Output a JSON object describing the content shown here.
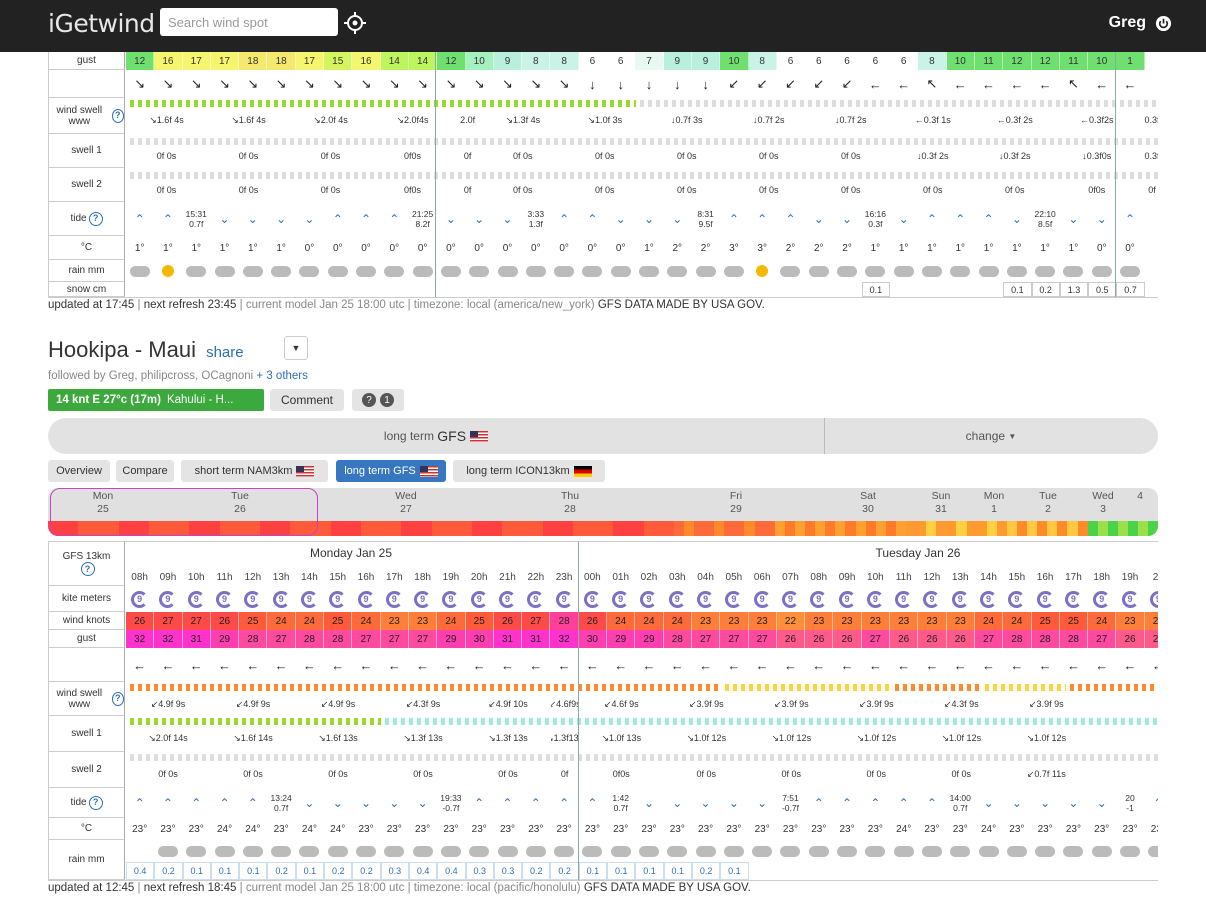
{
  "header": {
    "logo": "iGetwind",
    "search_placeholder": "Search wind spot",
    "user_name": "Greg"
  },
  "top_spot": {
    "row_labels": [
      "gust",
      "",
      "wind swell www",
      "swell 1",
      "swell 2",
      "tide",
      "°C",
      "rain mm",
      "snow cm"
    ],
    "gust": [
      "12",
      "16",
      "17",
      "17",
      "18",
      "18",
      "17",
      "15",
      "16",
      "14",
      "14",
      "12",
      "10",
      "9",
      "8",
      "8",
      "6",
      "6",
      "7",
      "9",
      "9",
      "10",
      "8",
      "6",
      "6",
      "6",
      "6",
      "6",
      "8",
      "10",
      "11",
      "12",
      "12",
      "11",
      "10",
      "1"
    ],
    "gust_colors": [
      "#6fe06f",
      "#f5f56e",
      "#f5f56e",
      "#f5f56e",
      "#f5e86e",
      "#f5e86e",
      "#f5f56e",
      "#d4f55e",
      "#f5f56e",
      "#bdf55e",
      "#bdf55e",
      "#6fe06f",
      "#a6f0c0",
      "#b8f0dd",
      "#c8f3e6",
      "#c8f3e6",
      "#fff",
      "#fff",
      "#eaf8f2",
      "#b8f0dd",
      "#b8f0dd",
      "#6fe06f",
      "#c8f3e6",
      "#fff",
      "#fff",
      "#fff",
      "#fff",
      "#fff",
      "#c8f3e6",
      "#6fe06f",
      "#6fe06f",
      "#6fe06f",
      "#6fe06f",
      "#6fe06f",
      "#6fe06f",
      "#6fe06f"
    ],
    "arrows": [
      "↘",
      "↘",
      "↘",
      "↘",
      "↘",
      "↘",
      "↘",
      "↘",
      "↘",
      "↘",
      "↘",
      "↘",
      "↘",
      "↘",
      "↘",
      "↘",
      "↓",
      "↓",
      "↓",
      "↓",
      "↓",
      "↙",
      "↙",
      "↙",
      "↙",
      "↙",
      "←",
      "←",
      "↖",
      "←",
      "←",
      "←",
      "←",
      "↖",
      "←",
      "←"
    ],
    "wind_swell": [
      "↘1.6f 4s",
      "↘1.6f 4s",
      "↘2.0f 4s",
      "↘2.0f4s",
      "2.0f",
      "↘1.3f 4s",
      "↘1.0f 3s",
      "↓0.7f 3s",
      "↓0.7f 2s",
      "↓0.7f 2s",
      "←0.3f 1s",
      "←0.3f 2s",
      "←0.3f2s",
      "0.3f"
    ],
    "swell1": [
      "0f 0s",
      "0f 0s",
      "0f 0s",
      "0f0s",
      "0f",
      "0f 0s",
      "0f 0s",
      "0f 0s",
      "0f 0s",
      "0f 0s",
      "↓0.3f 2s",
      "↓0.3f 2s",
      "↓0.3f0s",
      "0.3f"
    ],
    "swell2": [
      "0f 0s",
      "0f 0s",
      "0f 0s",
      "0f0s",
      "0f",
      "0f 0s",
      "0f 0s",
      "0f 0s",
      "0f 0s",
      "0f 0s",
      "0f 0s",
      "0f 0s",
      "0f0s",
      "0f"
    ],
    "tide_labels": [
      {
        "time": "15:31",
        "h": "0.7f"
      },
      {
        "time": "21:25",
        "h": "8.2f"
      },
      {
        "time": "3:33",
        "h": "1.3f"
      },
      {
        "time": "8:31",
        "h": "9.5f"
      },
      {
        "time": "16:16",
        "h": "0.3f"
      },
      {
        "time": "22:10",
        "h": "8.5f"
      }
    ],
    "temps": [
      "1°",
      "1°",
      "1°",
      "1°",
      "1°",
      "1°",
      "0°",
      "0°",
      "0°",
      "0°",
      "0°",
      "0°",
      "0°",
      "0°",
      "0°",
      "0°",
      "0°",
      "0°",
      "1°",
      "2°",
      "2°",
      "3°",
      "3°",
      "2°",
      "2°",
      "2°",
      "1°",
      "1°",
      "1°",
      "1°",
      "1°",
      "1°",
      "1°",
      "1°",
      "0°",
      "0°"
    ],
    "snow": [
      "0.1",
      "0.1",
      "0.2",
      "1.3",
      "0.5",
      "0.7"
    ],
    "footer_updated": "updated at 17:45",
    "footer_refresh": "next refresh 23:45",
    "footer_model": "current model Jan 25 18:00 utc",
    "footer_tz": "timezone: local (america/new_york)",
    "footer_gfs": "GFS DATA MADE BY USA GOV."
  },
  "spot": {
    "title": "Hookipa - Maui",
    "share": "share",
    "followed_prefix": "followed by",
    "followed_names": "Greg, philipcross, OCagnoni",
    "followed_more": "+ 3 others",
    "live_wind": "14 knt E 27°c (17m)",
    "live_station": "Kahului - H...",
    "comment_label": "Comment",
    "help_count": "1"
  },
  "model_bar": {
    "label": "long term",
    "model": "GFS",
    "change": "change"
  },
  "tabs": [
    {
      "label": "Overview"
    },
    {
      "label": "Compare"
    },
    {
      "label": "short term NAM3km"
    },
    {
      "label": "long term GFS"
    },
    {
      "label": "long term ICON13km"
    }
  ],
  "timeline_days": [
    {
      "d": "Mon",
      "n": "25"
    },
    {
      "d": "Tue",
      "n": "26"
    },
    {
      "d": "Wed",
      "n": "27"
    },
    {
      "d": "Thu",
      "n": "28"
    },
    {
      "d": "Fri",
      "n": "29"
    },
    {
      "d": "Sat",
      "n": "30"
    },
    {
      "d": "Sun",
      "n": "31"
    },
    {
      "d": "Mon",
      "n": "1"
    },
    {
      "d": "Tue",
      "n": "2"
    },
    {
      "d": "Wed",
      "n": "3"
    },
    {
      "d": "",
      "n": "4"
    }
  ],
  "forecast": {
    "model_label": "GFS 13km",
    "day1": "Monday Jan 25",
    "day2": "Tuesday Jan 26",
    "row_labels": [
      "kite meters",
      "wind knots",
      "gust",
      "",
      "wind swell www",
      "swell 1",
      "swell 2",
      "tide",
      "°C",
      "rain mm"
    ],
    "hours": [
      "08h",
      "09h",
      "10h",
      "11h",
      "12h",
      "13h",
      "14h",
      "15h",
      "16h",
      "17h",
      "18h",
      "19h",
      "20h",
      "21h",
      "22h",
      "23h",
      "00h",
      "01h",
      "02h",
      "03h",
      "04h",
      "05h",
      "06h",
      "07h",
      "08h",
      "09h",
      "10h",
      "11h",
      "12h",
      "13h",
      "14h",
      "15h",
      "16h",
      "17h",
      "18h",
      "19h",
      "20"
    ],
    "kite": [
      "9",
      "9",
      "9",
      "9",
      "9",
      "9",
      "9",
      "9",
      "9",
      "9",
      "9",
      "9",
      "9",
      "9",
      "9",
      "9",
      "9",
      "9",
      "9",
      "9",
      "9",
      "9",
      "9",
      "9",
      "9",
      "9",
      "9",
      "9",
      "9",
      "9",
      "9",
      "9",
      "9",
      "9",
      "9",
      "9",
      "9"
    ],
    "wind": [
      "26",
      "27",
      "27",
      "26",
      "25",
      "24",
      "24",
      "25",
      "24",
      "23",
      "23",
      "24",
      "25",
      "26",
      "27",
      "28",
      "26",
      "24",
      "24",
      "24",
      "23",
      "23",
      "23",
      "22",
      "23",
      "23",
      "23",
      "23",
      "23",
      "23",
      "24",
      "24",
      "25",
      "25",
      "24",
      "23",
      "23"
    ],
    "gust": [
      "32",
      "32",
      "31",
      "29",
      "28",
      "27",
      "28",
      "28",
      "27",
      "27",
      "27",
      "29",
      "30",
      "31",
      "31",
      "32",
      "30",
      "29",
      "29",
      "28",
      "27",
      "27",
      "27",
      "26",
      "26",
      "26",
      "27",
      "26",
      "26",
      "26",
      "27",
      "28",
      "28",
      "28",
      "27",
      "26",
      "26"
    ],
    "wind_swell": [
      "↙4.9f 9s",
      "↙4.9f 9s",
      "↙4.9f 9s",
      "↙4.3f 9s",
      "↙4.9f 10s",
      "↙4.6f9s",
      "↙4.6f 9s",
      "↙3.9f 9s",
      "↙3.9f 9s",
      "↙3.9f 9s",
      "↙4.3f 9s",
      "↙3.9f 9s"
    ],
    "swell1": [
      "↘2.0f 14s",
      "↘1.6f 14s",
      "↘1.6f 13s",
      "↘1.3f 13s",
      "↘1.3f 13s",
      "↘1.3f13s",
      "↘1.0f 13s",
      "↘1.0f 12s",
      "↘1.0f 12s",
      "↘1.0f 12s",
      "↘1.0f 12s",
      "↘1.0f 12s"
    ],
    "swell2": [
      "0f 0s",
      "0f 0s",
      "0f 0s",
      "0f 0s",
      "0f 0s",
      "0f",
      "0f0s",
      "0f 0s",
      "0f 0s",
      "0f 0s",
      "0f 0s",
      "↙0.7f 11s"
    ],
    "tide_labels": [
      {
        "time": "13:24",
        "h": "0.7f"
      },
      {
        "time": "19:33",
        "h": "-0.7f"
      },
      {
        "time": "1:42",
        "h": "0.7f"
      },
      {
        "time": "7:51",
        "h": "-0.7f"
      },
      {
        "time": "14:00",
        "h": "0.7f"
      },
      {
        "time": "20",
        "h": "-1"
      }
    ],
    "temps": [
      "23°",
      "23°",
      "23°",
      "24°",
      "24°",
      "23°",
      "24°",
      "24°",
      "23°",
      "23°",
      "23°",
      "23°",
      "23°",
      "23°",
      "23°",
      "23°",
      "23°",
      "23°",
      "23°",
      "23°",
      "23°",
      "23°",
      "23°",
      "23°",
      "23°",
      "23°",
      "23°",
      "24°",
      "23°",
      "23°",
      "24°",
      "23°",
      "23°",
      "23°",
      "23°",
      "23°",
      "23°"
    ],
    "rain": [
      "0.4",
      "0.2",
      "0.1",
      "0.1",
      "0.1",
      "0.2",
      "0.1",
      "0.2",
      "0.2",
      "0.3",
      "0.4",
      "0.4",
      "0.3",
      "0.3",
      "0.2",
      "0.2",
      "0.1",
      "0.1",
      "0.1",
      "0.1",
      "0.2",
      "0.1"
    ],
    "footer_updated": "updated at 12:45",
    "footer_refresh": "next refresh 18:45",
    "footer_model": "current model Jan 25 18:00 utc",
    "footer_tz": "timezone: local (pacific/honolulu)",
    "footer_gfs": "GFS DATA MADE BY USA GOV."
  },
  "colors": {
    "brand_bar": "#222222",
    "accent_blue": "#3677c0",
    "live_green": "#3ba93b",
    "high_wind": "#ff4040",
    "gust_magenta": "#ff3fa8"
  }
}
